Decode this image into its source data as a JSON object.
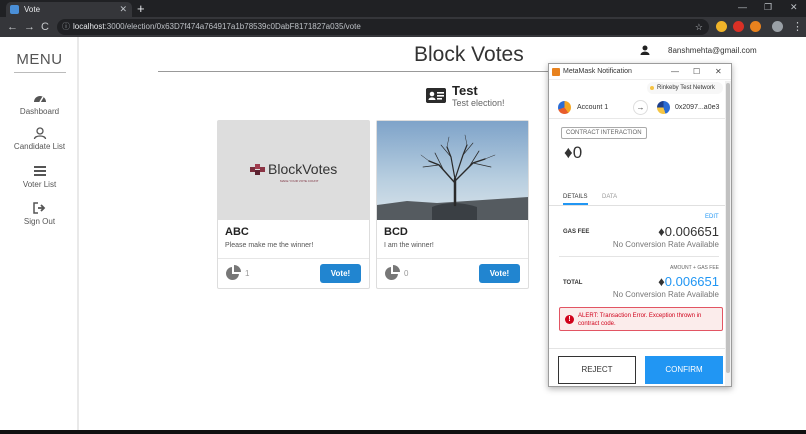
{
  "browser": {
    "tab_title": "Vote",
    "tab_close": "✕",
    "new_tab": "+",
    "url_host": "localhost",
    "url_rest": ":3000/election/0x63D7f474a764917a1b78539c0DabF8171827a035/vote",
    "window_controls": [
      "—",
      "❐",
      "✕"
    ],
    "nav": {
      "back": "←",
      "forward": "→",
      "reload": "C"
    },
    "info_icon": "ⓘ",
    "star": "☆"
  },
  "sidebar": {
    "title": "MENU",
    "items": [
      {
        "label": "Dashboard",
        "icon": "dashboard-icon"
      },
      {
        "label": "Candidate List",
        "icon": "user-icon"
      },
      {
        "label": "Voter List",
        "icon": "list-icon"
      },
      {
        "label": "Sign Out",
        "icon": "sign-out-icon"
      }
    ]
  },
  "header": {
    "brand": "Block Votes",
    "user_email": "8anshmehta@gmail.com"
  },
  "election": {
    "name": "Test",
    "description": "Test election!"
  },
  "candidates": [
    {
      "name": "ABC",
      "description": "Please make me the winner!",
      "votes": "1",
      "button": "Vote!",
      "image": "blockvotes-logo"
    },
    {
      "name": "BCD",
      "description": "I am the winner!",
      "votes": "0",
      "button": "Vote!",
      "image": "tree-photo"
    }
  ],
  "logo": {
    "text": "BlockVotes",
    "tagline": "MAKE YOUR VOTE COUNT"
  },
  "metamask": {
    "window_title": "MetaMask Notification",
    "window_controls": [
      "—",
      "☐",
      "✕"
    ],
    "network": "Rinkeby Test Network",
    "from_account": "Account 1",
    "arrow": "→",
    "to_address": "0x2097...a0e3",
    "badge": "CONTRACT INTERACTION",
    "amount": "0",
    "eth_symbol": "♦",
    "tabs": [
      "DETAILS",
      "DATA"
    ],
    "edit": "EDIT",
    "gas_fee_label": "GAS FEE",
    "gas_fee_value": "0.006651",
    "no_conversion": "No Conversion Rate Available",
    "amount_gas_label": "AMOUNT + GAS FEE",
    "total_label": "TOTAL",
    "total_value": "0.006651",
    "alert_icon": "!",
    "alert": "ALERT: Transaction Error. Exception thrown in contract code.",
    "reject": "REJECT",
    "confirm": "CONFIRM"
  },
  "colors": {
    "vote_button": "#2185d0",
    "metamask_blue": "#2196f3",
    "alert_red": "#d0021b"
  }
}
